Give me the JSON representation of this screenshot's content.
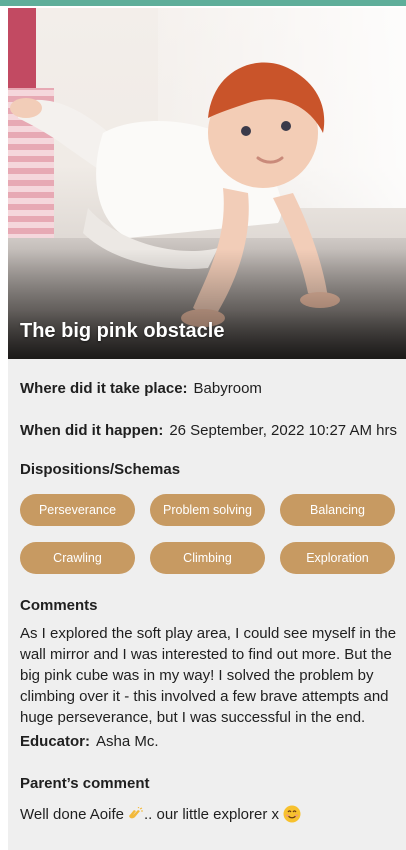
{
  "observation": {
    "title": "The big pink obstacle",
    "where_label": "Where did it take place:",
    "where_value": "Babyroom",
    "when_label": "When did it happen:",
    "when_value": "26 September, 2022 10:27 AM hrs",
    "dispositions_title": "Dispositions/Schemas",
    "dispositions": [
      "Perseverance",
      "Problem solving",
      "Balancing",
      "Crawling",
      "Climbing",
      "Exploration"
    ],
    "comments_title": "Comments",
    "comments_text": "As I explored the soft play area, I could see myself in the wall mirror and I was interested to find out more. But the big pink cube was in my way!  I solved the problem by climbing over it - this involved a few brave attempts and huge perseverance, but I was successful in the end.",
    "educator_label": "Educator:",
    "educator_value": "Asha Mc.",
    "parent_comment_title": "Parent’s comment",
    "parent_comment_part1": "Well done Aoife",
    "parent_comment_part2": ".. our little explorer x"
  },
  "icons": {
    "clap": "clapping-hands-icon",
    "smile": "smiling-face-icon"
  },
  "colors": {
    "chip_bg": "#c79a62",
    "chip_text": "#ffffff",
    "card_bg": "#efefef",
    "top_accent": "#5fae9a"
  }
}
